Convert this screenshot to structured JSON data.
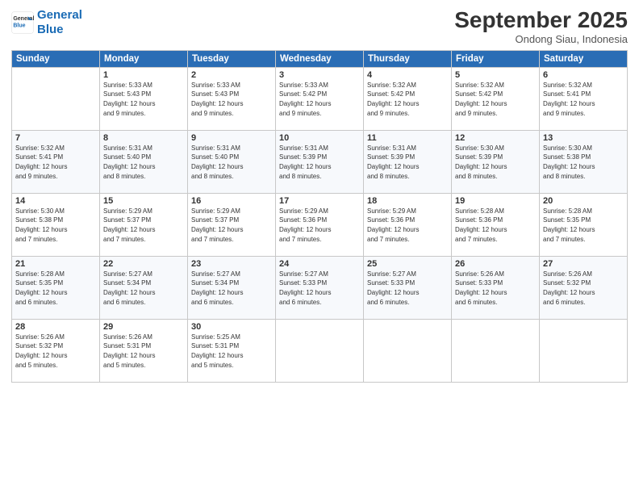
{
  "logo": {
    "line1": "General",
    "line2": "Blue"
  },
  "title": "September 2025",
  "subtitle": "Ondong Siau, Indonesia",
  "days_header": [
    "Sunday",
    "Monday",
    "Tuesday",
    "Wednesday",
    "Thursday",
    "Friday",
    "Saturday"
  ],
  "weeks": [
    [
      {
        "day": "",
        "info": ""
      },
      {
        "day": "1",
        "info": "Sunrise: 5:33 AM\nSunset: 5:43 PM\nDaylight: 12 hours\nand 9 minutes."
      },
      {
        "day": "2",
        "info": "Sunrise: 5:33 AM\nSunset: 5:43 PM\nDaylight: 12 hours\nand 9 minutes."
      },
      {
        "day": "3",
        "info": "Sunrise: 5:33 AM\nSunset: 5:42 PM\nDaylight: 12 hours\nand 9 minutes."
      },
      {
        "day": "4",
        "info": "Sunrise: 5:32 AM\nSunset: 5:42 PM\nDaylight: 12 hours\nand 9 minutes."
      },
      {
        "day": "5",
        "info": "Sunrise: 5:32 AM\nSunset: 5:42 PM\nDaylight: 12 hours\nand 9 minutes."
      },
      {
        "day": "6",
        "info": "Sunrise: 5:32 AM\nSunset: 5:41 PM\nDaylight: 12 hours\nand 9 minutes."
      }
    ],
    [
      {
        "day": "7",
        "info": "Sunrise: 5:32 AM\nSunset: 5:41 PM\nDaylight: 12 hours\nand 9 minutes."
      },
      {
        "day": "8",
        "info": "Sunrise: 5:31 AM\nSunset: 5:40 PM\nDaylight: 12 hours\nand 8 minutes."
      },
      {
        "day": "9",
        "info": "Sunrise: 5:31 AM\nSunset: 5:40 PM\nDaylight: 12 hours\nand 8 minutes."
      },
      {
        "day": "10",
        "info": "Sunrise: 5:31 AM\nSunset: 5:39 PM\nDaylight: 12 hours\nand 8 minutes."
      },
      {
        "day": "11",
        "info": "Sunrise: 5:31 AM\nSunset: 5:39 PM\nDaylight: 12 hours\nand 8 minutes."
      },
      {
        "day": "12",
        "info": "Sunrise: 5:30 AM\nSunset: 5:39 PM\nDaylight: 12 hours\nand 8 minutes."
      },
      {
        "day": "13",
        "info": "Sunrise: 5:30 AM\nSunset: 5:38 PM\nDaylight: 12 hours\nand 8 minutes."
      }
    ],
    [
      {
        "day": "14",
        "info": "Sunrise: 5:30 AM\nSunset: 5:38 PM\nDaylight: 12 hours\nand 7 minutes."
      },
      {
        "day": "15",
        "info": "Sunrise: 5:29 AM\nSunset: 5:37 PM\nDaylight: 12 hours\nand 7 minutes."
      },
      {
        "day": "16",
        "info": "Sunrise: 5:29 AM\nSunset: 5:37 PM\nDaylight: 12 hours\nand 7 minutes."
      },
      {
        "day": "17",
        "info": "Sunrise: 5:29 AM\nSunset: 5:36 PM\nDaylight: 12 hours\nand 7 minutes."
      },
      {
        "day": "18",
        "info": "Sunrise: 5:29 AM\nSunset: 5:36 PM\nDaylight: 12 hours\nand 7 minutes."
      },
      {
        "day": "19",
        "info": "Sunrise: 5:28 AM\nSunset: 5:36 PM\nDaylight: 12 hours\nand 7 minutes."
      },
      {
        "day": "20",
        "info": "Sunrise: 5:28 AM\nSunset: 5:35 PM\nDaylight: 12 hours\nand 7 minutes."
      }
    ],
    [
      {
        "day": "21",
        "info": "Sunrise: 5:28 AM\nSunset: 5:35 PM\nDaylight: 12 hours\nand 6 minutes."
      },
      {
        "day": "22",
        "info": "Sunrise: 5:27 AM\nSunset: 5:34 PM\nDaylight: 12 hours\nand 6 minutes."
      },
      {
        "day": "23",
        "info": "Sunrise: 5:27 AM\nSunset: 5:34 PM\nDaylight: 12 hours\nand 6 minutes."
      },
      {
        "day": "24",
        "info": "Sunrise: 5:27 AM\nSunset: 5:33 PM\nDaylight: 12 hours\nand 6 minutes."
      },
      {
        "day": "25",
        "info": "Sunrise: 5:27 AM\nSunset: 5:33 PM\nDaylight: 12 hours\nand 6 minutes."
      },
      {
        "day": "26",
        "info": "Sunrise: 5:26 AM\nSunset: 5:33 PM\nDaylight: 12 hours\nand 6 minutes."
      },
      {
        "day": "27",
        "info": "Sunrise: 5:26 AM\nSunset: 5:32 PM\nDaylight: 12 hours\nand 6 minutes."
      }
    ],
    [
      {
        "day": "28",
        "info": "Sunrise: 5:26 AM\nSunset: 5:32 PM\nDaylight: 12 hours\nand 5 minutes."
      },
      {
        "day": "29",
        "info": "Sunrise: 5:26 AM\nSunset: 5:31 PM\nDaylight: 12 hours\nand 5 minutes."
      },
      {
        "day": "30",
        "info": "Sunrise: 5:25 AM\nSunset: 5:31 PM\nDaylight: 12 hours\nand 5 minutes."
      },
      {
        "day": "",
        "info": ""
      },
      {
        "day": "",
        "info": ""
      },
      {
        "day": "",
        "info": ""
      },
      {
        "day": "",
        "info": ""
      }
    ]
  ]
}
